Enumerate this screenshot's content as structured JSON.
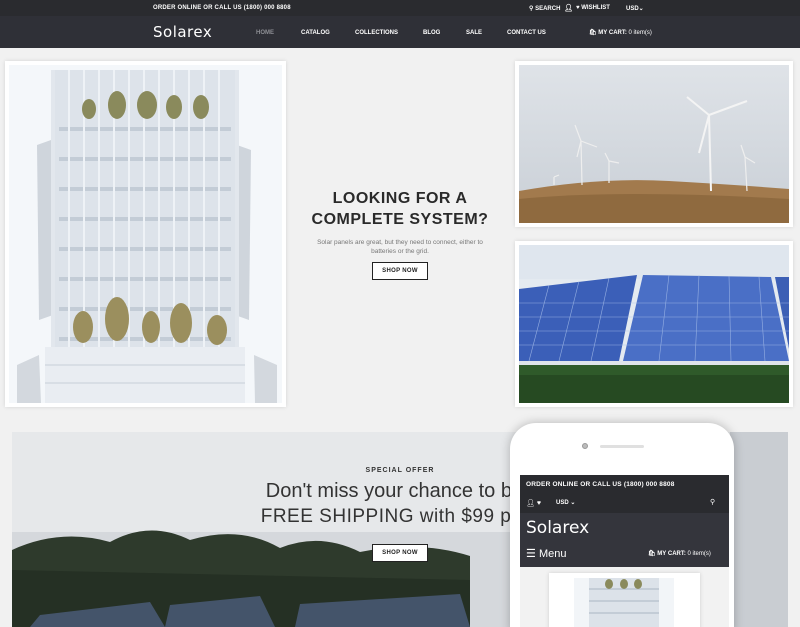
{
  "topbar": {
    "order_text": "ORDER ONLINE OR CALL US (1800) 000 8808",
    "search_label": "SEARCH",
    "wishlist_label": "WISHLIST",
    "currency": "USD"
  },
  "header": {
    "logo": "Solarex",
    "nav": [
      "HOME",
      "CATALOG",
      "COLLECTIONS",
      "BLOG",
      "SALE",
      "CONTACT US"
    ],
    "cart_label": "MY CART:",
    "cart_count": "0 item(s)"
  },
  "hero": {
    "title_line1": "LOOKING FOR A",
    "title_line2": "COMPLETE SYSTEM?",
    "text": "Solar panels are great, but they need to connect, either to batteries or the grid.",
    "button": "SHOP NOW"
  },
  "offer": {
    "kicker": "SPECIAL OFFER",
    "line1": "Don't miss your chance to be t",
    "line2": "FREE SHIPPING with $99 purc",
    "button": "SHOP NOW"
  },
  "mobile": {
    "order_text": "ORDER ONLINE OR CALL US (1800) 000 8808",
    "currency": "USD",
    "logo": "Solarex",
    "menu_label": "Menu",
    "cart_label": "MY CART:",
    "cart_count": "0 item(s)"
  },
  "colors": {
    "topbar": "#2a2b2f",
    "navbar": "#2f3037",
    "page_bg": "#f1f1f1"
  },
  "icons": [
    "search-icon",
    "user-icon",
    "heart-icon",
    "chevron-down-icon",
    "cart-icon",
    "hamburger-icon"
  ]
}
